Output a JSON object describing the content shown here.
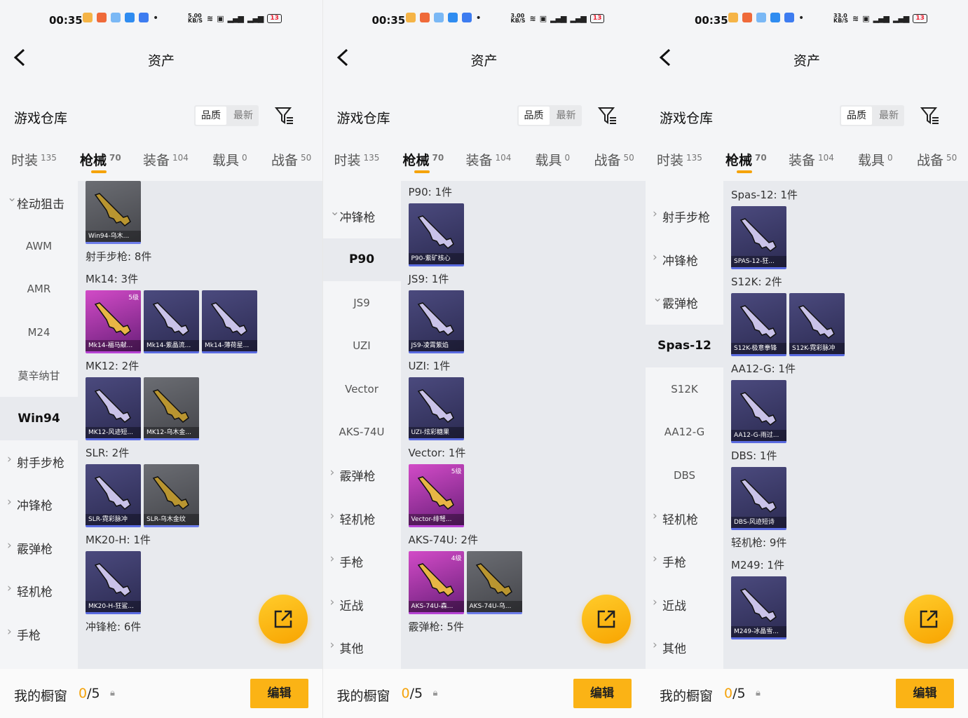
{
  "status_bar": {
    "time": "00:35",
    "speeds": [
      "5.00\nKB/S",
      "3.00\nKB/S",
      "33.0\nKB/S"
    ],
    "battery": "13"
  },
  "nav": {
    "title": "资产"
  },
  "warehouse": {
    "title": "游戏仓库",
    "sort_options": [
      "品质",
      "最新"
    ]
  },
  "tabs": [
    {
      "label": "时装",
      "count": "135"
    },
    {
      "label": "枪械",
      "count": "70"
    },
    {
      "label": "装备",
      "count": "104"
    },
    {
      "label": "载具",
      "count": "0"
    },
    {
      "label": "战备",
      "count": "50"
    }
  ],
  "bottom": {
    "label": "我的橱窗",
    "count": "0",
    "total": "/5",
    "edit": "编辑"
  },
  "panels": [
    {
      "side": [
        {
          "label": "栓动狙击",
          "type": "open"
        },
        {
          "label": "AWM",
          "type": "sub"
        },
        {
          "label": "AMR",
          "type": "sub"
        },
        {
          "label": "M24",
          "type": "sub"
        },
        {
          "label": "莫辛纳甘",
          "type": "sub"
        },
        {
          "label": "Win94",
          "type": "sel"
        },
        {
          "label": "射手步枪",
          "type": "cat"
        },
        {
          "label": "冲锋枪",
          "type": "cat"
        },
        {
          "label": "霰弹枪",
          "type": "cat"
        },
        {
          "label": "轻机枪",
          "type": "cat"
        },
        {
          "label": "手枪",
          "type": "cat"
        }
      ],
      "top_pad": 0,
      "groups": [
        {
          "title": "",
          "cards": [
            {
              "name": "Win94-乌木...",
              "style": "grey"
            }
          ]
        },
        {
          "title": "射手步枪: 8件",
          "cards": []
        },
        {
          "title": "Mk14: 3件",
          "cards": [
            {
              "name": "Mk14-福马献...",
              "style": "pink",
              "level": "5级"
            },
            {
              "name": "Mk14-紫晶流...",
              "style": "blue"
            },
            {
              "name": "Mk14-薄荷星...",
              "style": "blue"
            }
          ]
        },
        {
          "title": "MK12: 2件",
          "cards": [
            {
              "name": "MK12-风迹短...",
              "style": "blue"
            },
            {
              "name": "MK12-乌木金...",
              "style": "grey"
            }
          ]
        },
        {
          "title": "SLR: 2件",
          "cards": [
            {
              "name": "SLR-霓彩脉冲",
              "style": "blue"
            },
            {
              "name": "SLR-乌木金纹",
              "style": "grey"
            }
          ]
        },
        {
          "title": "MK20-H: 1件",
          "cards": [
            {
              "name": "MK20-H-狂鲨...",
              "style": "blue"
            }
          ]
        },
        {
          "title": "冲锋枪: 6件",
          "cards": []
        }
      ]
    },
    {
      "side": [
        {
          "label": "",
          "type": "blank"
        },
        {
          "label": "冲锋枪",
          "type": "open"
        },
        {
          "label": "P90",
          "type": "sel"
        },
        {
          "label": "JS9",
          "type": "sub"
        },
        {
          "label": "UZI",
          "type": "sub"
        },
        {
          "label": "Vector",
          "type": "sub"
        },
        {
          "label": "AKS-74U",
          "type": "sub"
        },
        {
          "label": "霰弹枪",
          "type": "cat"
        },
        {
          "label": "轻机枪",
          "type": "cat"
        },
        {
          "label": "手枪",
          "type": "cat"
        },
        {
          "label": "近战",
          "type": "cat"
        },
        {
          "label": "其他",
          "type": "cat"
        }
      ],
      "top_pad": 0,
      "groups": [
        {
          "title": "P90: 1件",
          "cards": [
            {
              "name": "P90-紫矿核心",
              "style": "blue"
            }
          ]
        },
        {
          "title": "JS9: 1件",
          "cards": [
            {
              "name": "JS9-凌霄紫焰",
              "style": "blue"
            }
          ]
        },
        {
          "title": "UZI: 1件",
          "cards": [
            {
              "name": "UZI-炫彩糖果",
              "style": "blue"
            }
          ]
        },
        {
          "title": "Vector: 1件",
          "cards": [
            {
              "name": "Vector-绯弩...",
              "style": "pink",
              "level": "5级"
            }
          ]
        },
        {
          "title": "AKS-74U: 2件",
          "cards": [
            {
              "name": "AKS-74U-森...",
              "style": "pink",
              "level": "4级"
            },
            {
              "name": "AKS-74U-乌...",
              "style": "grey"
            }
          ]
        },
        {
          "title": "霰弹枪: 5件",
          "cards": []
        }
      ]
    },
    {
      "side": [
        {
          "label": "",
          "type": "blank"
        },
        {
          "label": "射手步枪",
          "type": "cat"
        },
        {
          "label": "冲锋枪",
          "type": "cat"
        },
        {
          "label": "霰弹枪",
          "type": "open"
        },
        {
          "label": "Spas-12",
          "type": "sel"
        },
        {
          "label": "S12K",
          "type": "sub"
        },
        {
          "label": "AA12-G",
          "type": "sub"
        },
        {
          "label": "DBS",
          "type": "sub"
        },
        {
          "label": "轻机枪",
          "type": "cat"
        },
        {
          "label": "手枪",
          "type": "cat"
        },
        {
          "label": "近战",
          "type": "cat"
        },
        {
          "label": "其他",
          "type": "cat"
        }
      ],
      "top_pad": 4,
      "groups": [
        {
          "title": "Spas-12: 1件",
          "cards": [
            {
              "name": "SPAS-12-狂...",
              "style": "blue"
            }
          ]
        },
        {
          "title": "S12K: 2件",
          "cards": [
            {
              "name": "S12K-极意拳锋",
              "style": "blue"
            },
            {
              "name": "S12K-霓彩脉冲",
              "style": "blue"
            }
          ]
        },
        {
          "title": "AA12-G: 1件",
          "cards": [
            {
              "name": "AA12-G-雨过...",
              "style": "blue"
            }
          ]
        },
        {
          "title": "DBS: 1件",
          "cards": [
            {
              "name": "DBS-风迹短诗",
              "style": "blue"
            }
          ]
        },
        {
          "title": "轻机枪: 9件",
          "cards": []
        },
        {
          "title": "M249: 1件",
          "cards": [
            {
              "name": "M249-冰晶雪...",
              "style": "blue"
            }
          ]
        }
      ]
    }
  ]
}
